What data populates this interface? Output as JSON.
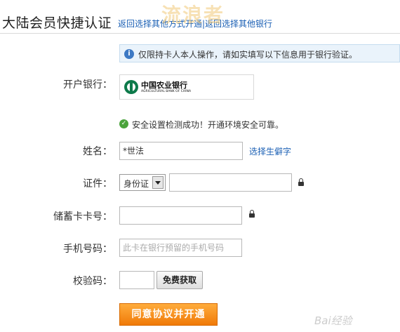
{
  "header": {
    "title": "大陆会员快捷认证",
    "back_link": "返回选择其他方式开通|返回选择其他银行",
    "watermark": "流浪者"
  },
  "notice": {
    "text": "仅限持卡人本人操作，请如实填写以下信息用于银行验证。"
  },
  "bank": {
    "label": "开户银行：",
    "name_cn": "中国农业银行",
    "name_en": "AGRICULTURAL BANK OF CHINA",
    "brand_color": "#0d7a4a"
  },
  "security": {
    "text": "安全设置检测成功！开通环境安全可靠。"
  },
  "name_field": {
    "label": "姓名：",
    "value": "*世法",
    "rare_char_link": "选择生僻字"
  },
  "id_field": {
    "label": "证件：",
    "type_selected": "身份证",
    "value": ""
  },
  "card_field": {
    "label": "储蓄卡卡号：",
    "value": ""
  },
  "phone_field": {
    "label": "手机号码：",
    "placeholder": "此卡在银行预留的手机号码"
  },
  "code_field": {
    "label": "校验码：",
    "value": "",
    "get_code_label": "免费获取"
  },
  "submit": {
    "label": "同意协议并开通"
  },
  "footer": {
    "watermark": "Bai经验"
  },
  "colors": {
    "link": "#1a5fb4",
    "submit": "#f07a08",
    "notice_bg": "#eaf3fb",
    "success": "#4aa33b"
  }
}
